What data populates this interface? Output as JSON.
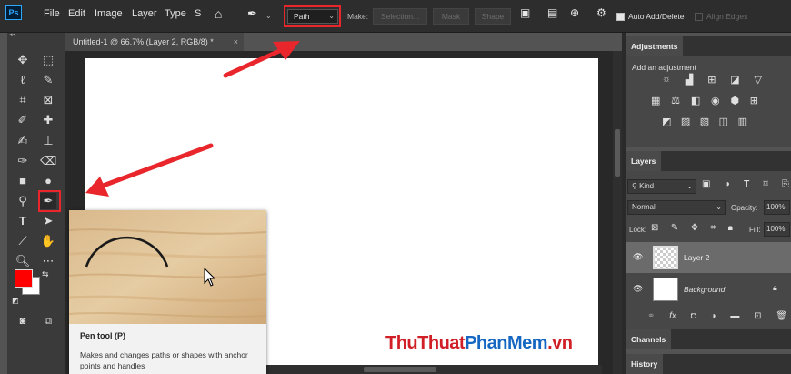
{
  "menubar": {
    "logo": "Ps",
    "items": [
      "File",
      "Edit",
      "Image",
      "Layer",
      "Type",
      "S"
    ]
  },
  "options_bar": {
    "path_mode": "Path",
    "make_label": "Make:",
    "selection_btn": "Selection...",
    "mask_btn": "Mask",
    "shape_btn": "Shape",
    "auto_add_delete": "Auto Add/Delete",
    "align_edges": "Align Edges"
  },
  "document": {
    "tab_title": "Untitled-1 @ 66.7% (Layer 2, RGB/8) *",
    "close": "×"
  },
  "tooltip": {
    "title": "Pen tool (P)",
    "description": "Makes and changes paths or shapes with anchor points and handles"
  },
  "watermark": {
    "part1": "ThuThuat",
    "part2": "PhanMem",
    "part3": ".vn"
  },
  "panels": {
    "adjustments": {
      "tab": "Adjustments",
      "hint": "Add an adjustment"
    },
    "layers": {
      "tab": "Layers",
      "filter": "Kind",
      "blend_mode": "Normal",
      "opacity_label": "Opacity:",
      "opacity_value": "100%",
      "lock_label": "Lock:",
      "fill_label": "Fill:",
      "fill_value": "100%",
      "items": [
        {
          "name": "Layer 2"
        },
        {
          "name": "Background"
        }
      ]
    },
    "channels": {
      "tab": "Channels"
    },
    "history": {
      "tab": "History"
    }
  },
  "colors": {
    "accent_red": "#e8262b",
    "foreground": "#ff0000",
    "background": "#ffffff",
    "watermark_red": "#d01f26",
    "watermark_blue": "#1667c2"
  },
  "icons": {
    "tools": [
      "move-icon",
      "marquee-icon",
      "lasso-icon",
      "quick-select-icon",
      "crop-icon",
      "frame-icon",
      "eyedropper-icon",
      "healing-icon",
      "brush-icon",
      "stamp-icon",
      "history-brush-icon",
      "eraser-icon",
      "gradient-icon",
      "blur-icon",
      "dodge-icon",
      "pen-icon",
      "type-icon",
      "path-select-icon",
      "line-icon",
      "hand-icon",
      "zoom-icon",
      "more-icon"
    ]
  }
}
